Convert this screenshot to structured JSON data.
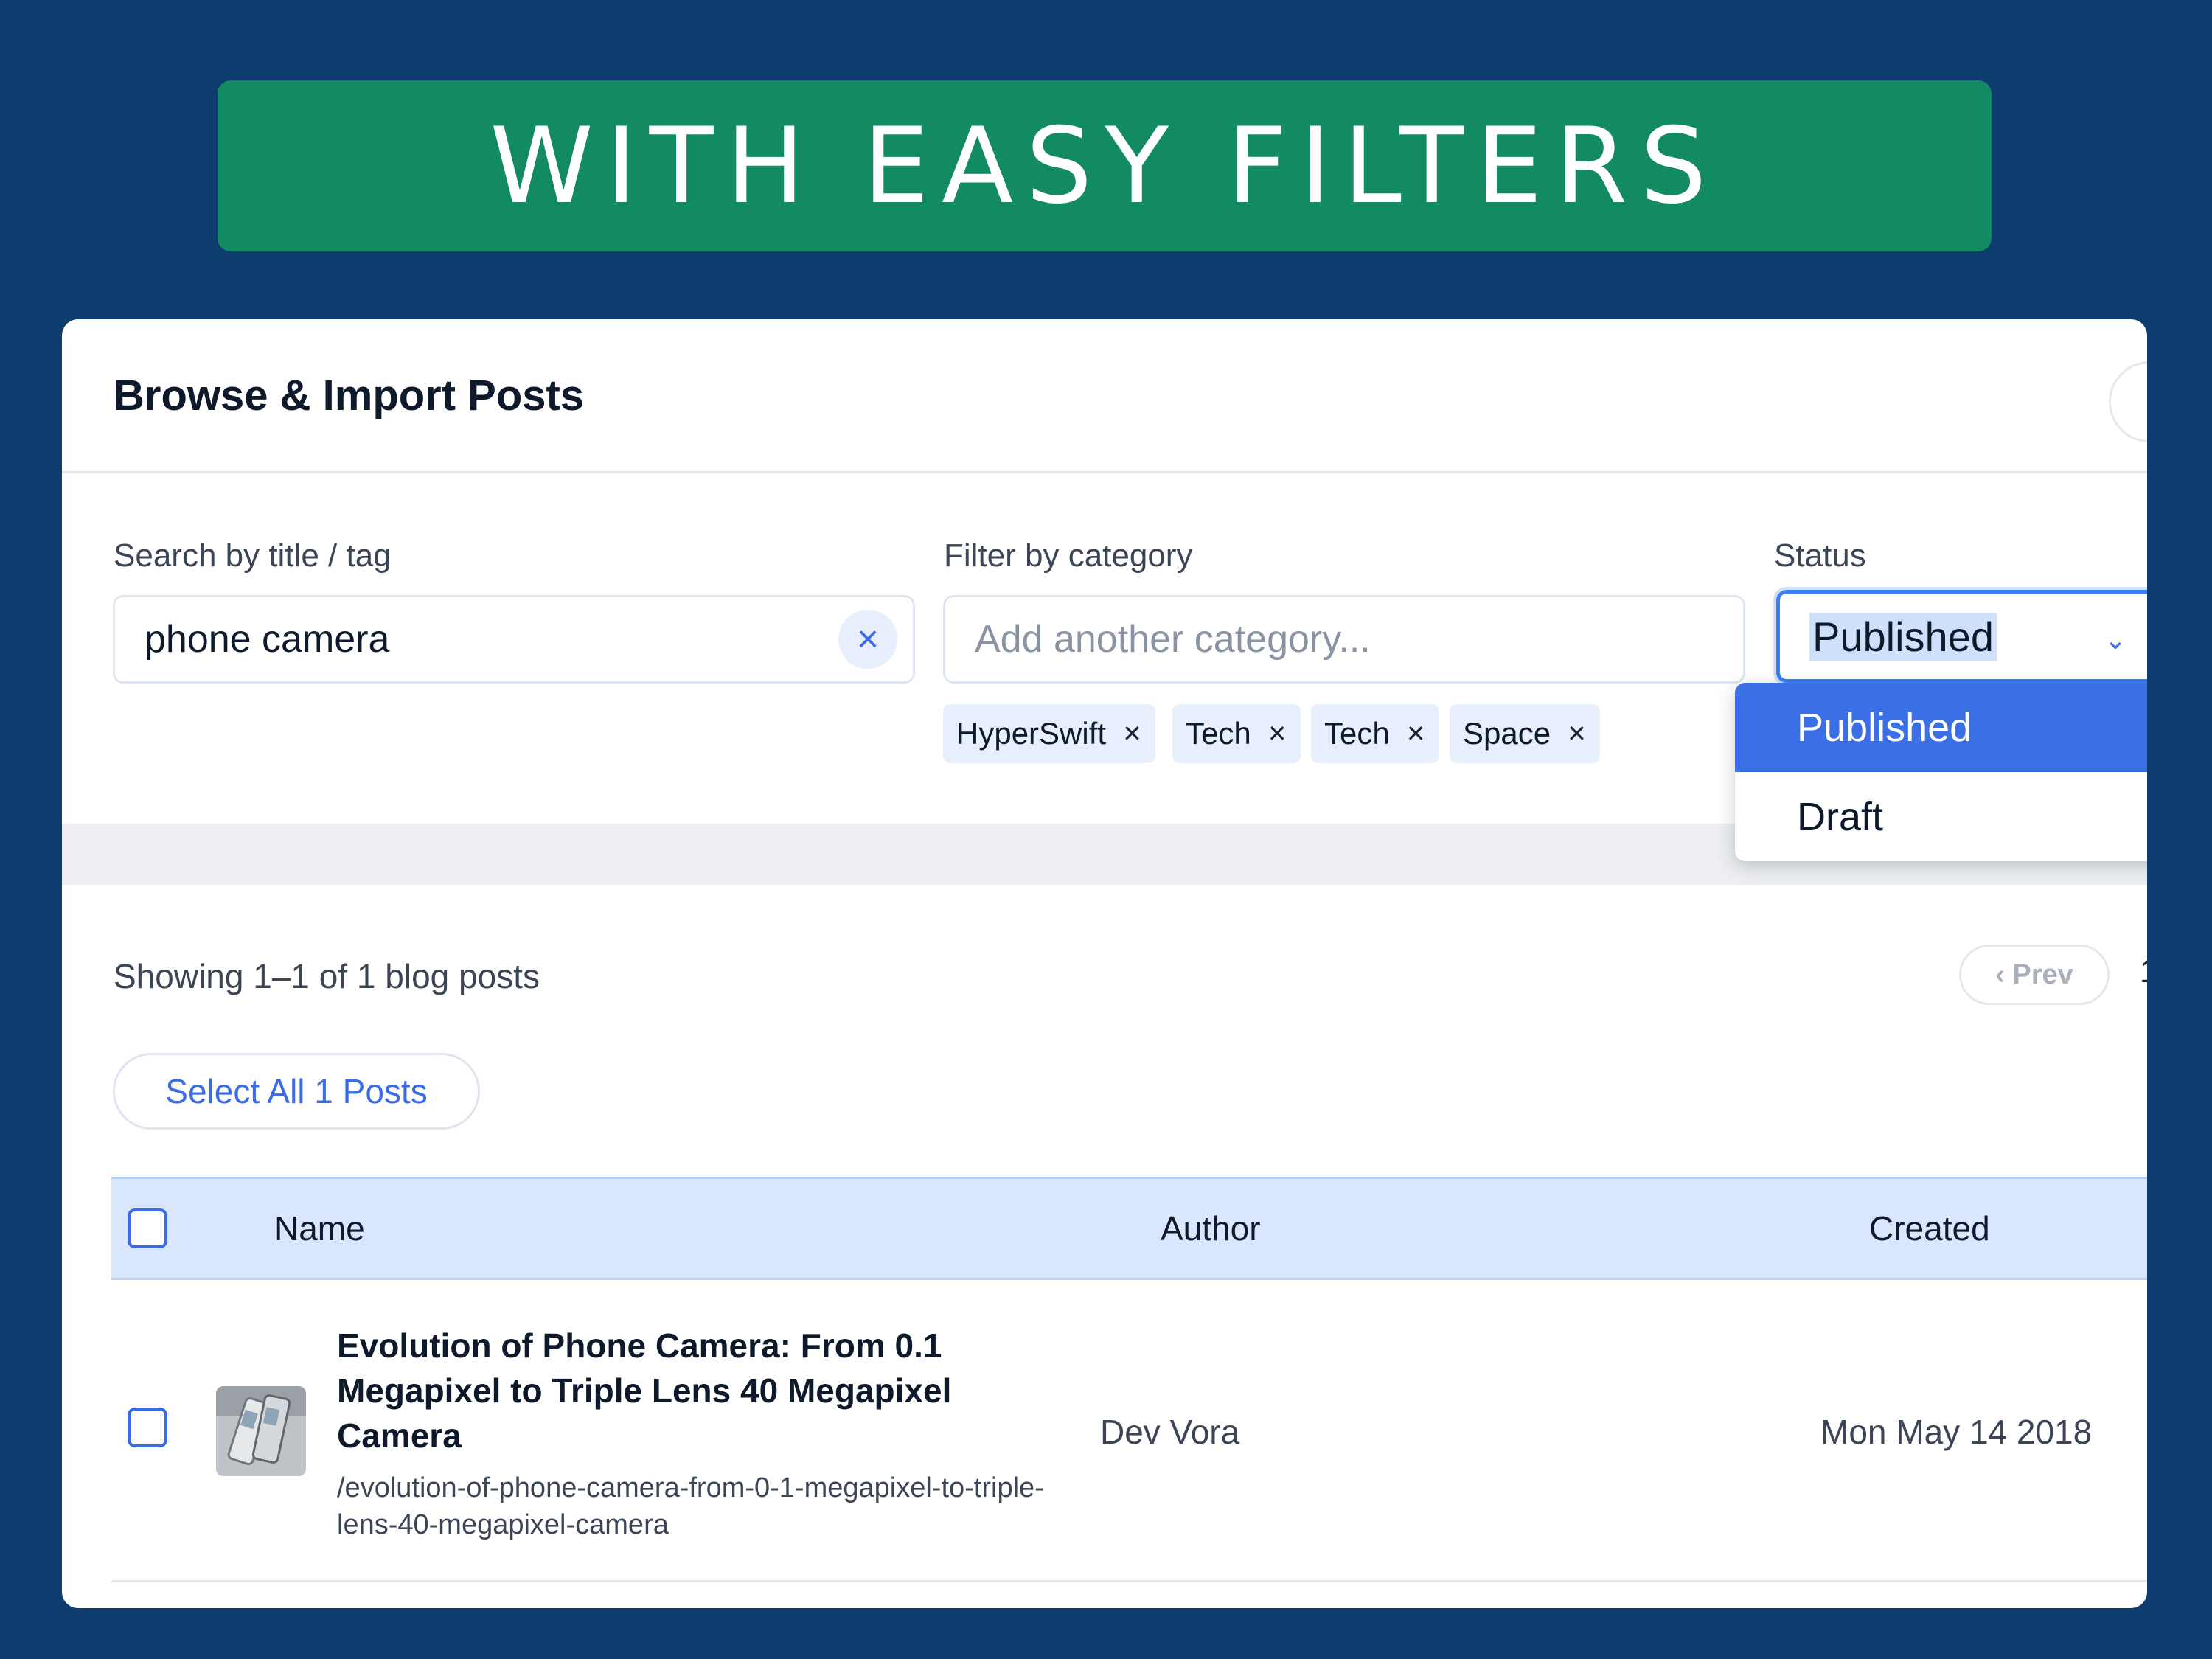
{
  "banner": {
    "text": "WITH EASY FILTERS"
  },
  "card": {
    "title": "Browse & Import Posts"
  },
  "filters": {
    "search_label": "Search by title / tag",
    "search_value": "phone camera",
    "category_label": "Filter by category",
    "category_placeholder": "Add another category...",
    "chips": [
      "HyperSwift",
      "Tech",
      "Tech",
      "Space"
    ],
    "status_label": "Status",
    "status_value": "Published",
    "status_options": [
      "Published",
      "Draft"
    ]
  },
  "results": {
    "showing_text": "Showing 1–1 of 1 blog posts",
    "prev_label": "‹ Prev",
    "page_partial": "1",
    "select_all_label": "Select All 1 Posts"
  },
  "table": {
    "columns": [
      "Name",
      "Author",
      "Created"
    ],
    "rows": [
      {
        "title": "Evolution of Phone Camera: From 0.1 Megapixel to Triple Lens 40 Megapixel Camera",
        "slug": "/evolution-of-phone-camera-from-0-1-megapixel-to-triple-lens-40-megapixel-camera",
        "author": "Dev Vora",
        "created": "Mon May 14 2018"
      }
    ]
  },
  "icons": {
    "clear": "close-icon",
    "chip_remove": "close-icon",
    "dropdown": "chevron-down-icon"
  },
  "colors": {
    "background": "#0d3d6e",
    "banner": "#128a63",
    "accent": "#3a6be8",
    "dropdown_active": "#3b6fe6",
    "table_header": "#d9e6fc"
  }
}
